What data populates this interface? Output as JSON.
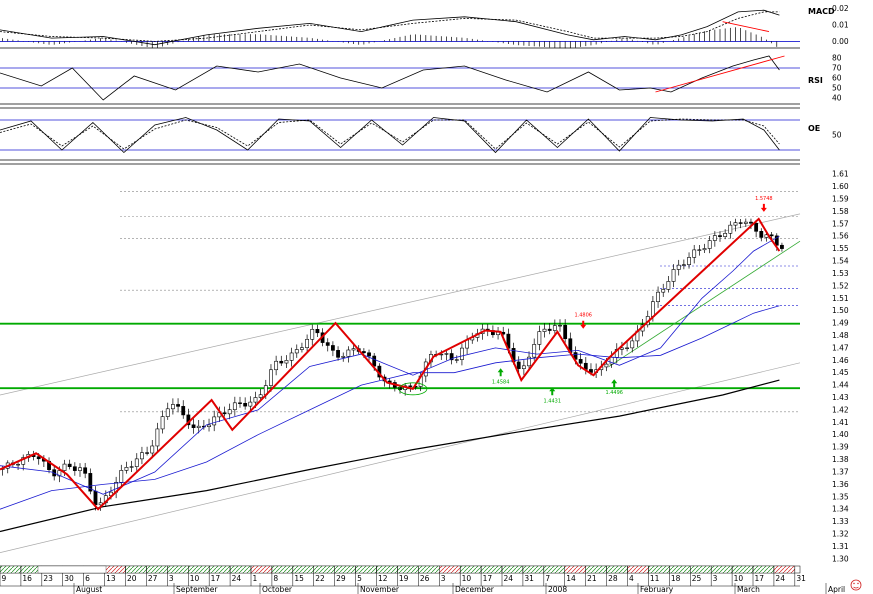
{
  "chart_data": [
    {
      "panel": "macd",
      "type": "line",
      "title": "MACD",
      "yticks": [
        0.02,
        0.01,
        0.0
      ],
      "ylim": [
        -0.004,
        0.024
      ],
      "series": [
        {
          "role": "macd",
          "x": [
            0,
            10,
            20,
            30,
            40,
            50,
            60,
            70,
            80,
            90,
            100,
            110,
            115,
            121,
            127,
            132,
            137,
            143,
            148,
            151
          ],
          "values": [
            0.007,
            0.002,
            0.003,
            -0.002,
            0.004,
            0.008,
            0.011,
            0.006,
            0.013,
            0.015,
            0.012,
            0.004,
            0.001,
            0.003,
            0.001,
            0.004,
            0.009,
            0.018,
            0.019,
            0.016
          ]
        },
        {
          "role": "signal",
          "x": [
            0,
            10,
            20,
            30,
            40,
            50,
            60,
            70,
            80,
            90,
            100,
            110,
            115,
            121,
            127,
            132,
            137,
            143,
            148,
            151
          ],
          "values": [
            0.006,
            0.003,
            0.002,
            0.0,
            0.002,
            0.006,
            0.01,
            0.007,
            0.011,
            0.014,
            0.013,
            0.006,
            0.002,
            0.002,
            0.002,
            0.003,
            0.006,
            0.014,
            0.018,
            0.018
          ]
        }
      ],
      "annotations": [
        {
          "type": "trendline",
          "color": "#ff0000",
          "x": [
            140,
            149
          ],
          "values": [
            0.012,
            0.006
          ]
        }
      ]
    },
    {
      "panel": "rsi",
      "type": "line",
      "title": "RSI",
      "yticks": [
        80,
        70,
        60,
        50,
        40
      ],
      "ylim": [
        34,
        86
      ],
      "reference_lines": [
        70,
        50
      ],
      "series": [
        {
          "role": "rsi",
          "x": [
            0,
            8,
            14,
            20,
            26,
            34,
            42,
            50,
            58,
            66,
            74,
            82,
            90,
            98,
            106,
            114,
            120,
            126,
            130,
            136,
            142,
            146,
            149,
            151
          ],
          "values": [
            65,
            52,
            70,
            38,
            62,
            48,
            72,
            66,
            74,
            60,
            50,
            68,
            72,
            58,
            46,
            66,
            48,
            50,
            46,
            60,
            72,
            78,
            82,
            68
          ]
        }
      ],
      "annotations": [
        {
          "type": "trendline",
          "color": "#ff0000",
          "x": [
            127,
            152
          ],
          "values": [
            46,
            82
          ]
        }
      ]
    },
    {
      "panel": "oe",
      "type": "line",
      "title": "OE",
      "yticks": [
        50
      ],
      "ylim": [
        0,
        100
      ],
      "reference_lines": [
        80,
        20
      ],
      "series": [
        {
          "role": "oe",
          "x": [
            0,
            6,
            12,
            18,
            24,
            30,
            36,
            42,
            48,
            54,
            60,
            66,
            72,
            78,
            84,
            90,
            96,
            102,
            108,
            114,
            120,
            126,
            132,
            138,
            144,
            148,
            151
          ],
          "values": [
            60,
            78,
            20,
            75,
            15,
            70,
            85,
            60,
            20,
            82,
            78,
            25,
            80,
            30,
            85,
            78,
            15,
            80,
            25,
            82,
            18,
            85,
            80,
            78,
            82,
            60,
            20
          ]
        },
        {
          "role": "oe-signal",
          "x": [
            0,
            6,
            12,
            18,
            24,
            30,
            36,
            42,
            48,
            54,
            60,
            66,
            72,
            78,
            84,
            90,
            96,
            102,
            108,
            114,
            120,
            126,
            132,
            138,
            144,
            148,
            151
          ],
          "values": [
            55,
            72,
            28,
            68,
            22,
            62,
            80,
            65,
            28,
            75,
            80,
            32,
            74,
            36,
            80,
            80,
            22,
            74,
            32,
            76,
            26,
            78,
            82,
            80,
            80,
            68,
            32
          ]
        }
      ]
    },
    {
      "panel": "price",
      "type": "line",
      "subtype": "candlestick-with-moving-averages",
      "ylim": [
        1.295,
        1.615
      ],
      "yticks": [
        1.61,
        1.6,
        1.59,
        1.58,
        1.57,
        1.56,
        1.55,
        1.54,
        1.53,
        1.52,
        1.51,
        1.5,
        1.49,
        1.48,
        1.47,
        1.46,
        1.45,
        1.44,
        1.43,
        1.42,
        1.41,
        1.4,
        1.39,
        1.38,
        1.37,
        1.36,
        1.35,
        1.34,
        1.33,
        1.32,
        1.31,
        1.3
      ],
      "xlim": [
        0,
        155
      ],
      "series": [
        {
          "role": "price-close",
          "x": [
            0,
            7,
            10,
            13,
            16,
            19,
            24,
            29,
            33,
            38,
            45,
            50,
            53,
            57,
            61,
            65,
            70,
            75,
            80,
            84,
            88,
            92,
            97,
            101,
            104,
            108,
            112,
            116,
            118,
            123,
            127,
            131,
            134,
            138,
            144,
            147,
            149,
            151
          ],
          "values": [
            1.372,
            1.385,
            1.368,
            1.375,
            1.372,
            1.34,
            1.372,
            1.388,
            1.428,
            1.403,
            1.423,
            1.428,
            1.456,
            1.465,
            1.485,
            1.463,
            1.47,
            1.44,
            1.437,
            1.468,
            1.46,
            1.483,
            1.483,
            1.448,
            1.48,
            1.49,
            1.456,
            1.45,
            1.462,
            1.477,
            1.51,
            1.534,
            1.545,
            1.557,
            1.574,
            1.562,
            1.56,
            1.552
          ]
        },
        {
          "role": "ma-short",
          "x": [
            0,
            10,
            20,
            30,
            40,
            50,
            60,
            70,
            80,
            88,
            96,
            104,
            112,
            120,
            128,
            136,
            142,
            146,
            151
          ],
          "values": [
            1.375,
            1.37,
            1.352,
            1.37,
            1.408,
            1.42,
            1.455,
            1.465,
            1.448,
            1.462,
            1.47,
            1.465,
            1.468,
            1.456,
            1.47,
            1.51,
            1.532,
            1.548,
            1.56
          ]
        },
        {
          "role": "ma-medium",
          "x": [
            0,
            10,
            20,
            30,
            40,
            50,
            60,
            70,
            80,
            88,
            96,
            104,
            112,
            120,
            128,
            136,
            142,
            146,
            151
          ],
          "values": [
            1.34,
            1.355,
            1.36,
            1.364,
            1.378,
            1.4,
            1.42,
            1.44,
            1.45,
            1.45,
            1.458,
            1.462,
            1.465,
            1.462,
            1.464,
            1.478,
            1.49,
            1.498,
            1.504
          ]
        },
        {
          "role": "ma-long",
          "x": [
            0,
            20,
            40,
            60,
            80,
            100,
            120,
            140,
            151
          ],
          "values": [
            1.322,
            1.342,
            1.355,
            1.372,
            1.388,
            1.402,
            1.415,
            1.432,
            1.444
          ]
        }
      ],
      "horizontal_lines": [
        {
          "value": 1.4895,
          "color": "#00aa00"
        },
        {
          "value": 1.4375,
          "color": "#00aa00"
        }
      ],
      "retracement_lines": [
        1.596,
        1.576,
        1.558,
        1.536,
        1.518,
        1.504
      ],
      "channel_lines": [
        {
          "x": [
            0,
            155
          ],
          "values": [
            1.432,
            1.578
          ]
        },
        {
          "x": [
            0,
            155
          ],
          "values": [
            1.305,
            1.458
          ]
        }
      ],
      "zigzag": {
        "x": [
          0,
          7,
          13,
          19,
          41,
          45,
          65,
          75,
          80,
          84,
          94,
          97,
          101,
          108,
          112,
          115,
          118,
          147,
          149,
          151
        ],
        "values": [
          1.372,
          1.385,
          1.368,
          1.34,
          1.428,
          1.404,
          1.49,
          1.442,
          1.437,
          1.463,
          1.484,
          1.483,
          1.444,
          1.483,
          1.456,
          1.448,
          1.462,
          1.574,
          1.56,
          1.548
        ]
      },
      "annotations": [
        {
          "text": "1.4806",
          "x": 113,
          "value": 1.4806,
          "color": "#ff0000",
          "marker": "down-arrow"
        },
        {
          "text": "1.5748",
          "x": 148,
          "value": 1.5748,
          "color": "#ff0000",
          "marker": "down-arrow"
        },
        {
          "text": "1.4584",
          "x": 97,
          "value": 1.4584,
          "color": "#00aa00",
          "marker": "up-arrow"
        },
        {
          "text": "1.4431",
          "x": 107,
          "value": 1.4431,
          "color": "#00aa00",
          "marker": "up-arrow"
        },
        {
          "text": "1.4496",
          "x": 119,
          "value": 1.4496,
          "color": "#00aa00",
          "marker": "up-arrow"
        }
      ],
      "x_ticks": [
        "9",
        "16",
        "23",
        "30",
        "6",
        "13",
        "20",
        "27",
        "3",
        "10",
        "17",
        "24",
        "1",
        "8",
        "15",
        "22",
        "29",
        "5",
        "12",
        "19",
        "26",
        "3",
        "10",
        "17",
        "24",
        "31",
        "7",
        "14",
        "21",
        "28",
        "4",
        "11",
        "18",
        "25",
        "3",
        "10",
        "17",
        "24",
        "31"
      ],
      "months": [
        "August",
        "September",
        "October",
        "November",
        "December",
        "2008",
        "February",
        "March",
        "April"
      ]
    }
  ]
}
